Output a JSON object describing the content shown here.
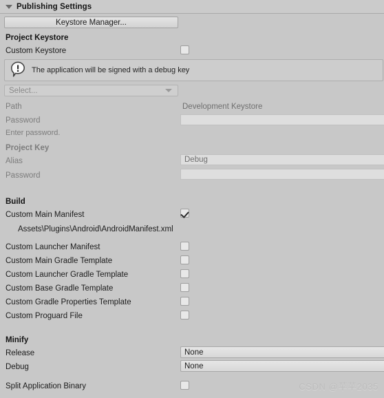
{
  "header": {
    "title": "Publishing Settings",
    "foldout_icon": "triangle-down-icon"
  },
  "keystore_manager_button": {
    "label": "Keystore Manager..."
  },
  "sections": {
    "project_keystore": {
      "title": "Project Keystore",
      "custom_keystore": {
        "label": "Custom Keystore",
        "checked": false
      },
      "helpbox": {
        "icon": "info-exclamation-icon",
        "text": "The application will be signed with a debug key"
      },
      "keystore_select": {
        "value": "Select...",
        "arrow_icon": "chevron-down-icon"
      },
      "path": {
        "label": "Path",
        "value": "Development Keystore"
      },
      "password": {
        "label": "Password",
        "value": "",
        "hint": "Enter password."
      }
    },
    "project_key": {
      "title": "Project Key",
      "alias": {
        "label": "Alias",
        "value": "Debug"
      },
      "password": {
        "label": "Password",
        "value": ""
      }
    },
    "build": {
      "title": "Build",
      "custom_main_manifest": {
        "label": "Custom Main Manifest",
        "checked": true,
        "path": "Assets\\Plugins\\Android\\AndroidManifest.xml"
      },
      "items": [
        {
          "label": "Custom Launcher Manifest",
          "checked": false
        },
        {
          "label": "Custom Main Gradle Template",
          "checked": false
        },
        {
          "label": "Custom Launcher Gradle Template",
          "checked": false
        },
        {
          "label": "Custom Base Gradle Template",
          "checked": false
        },
        {
          "label": "Custom Gradle Properties Template",
          "checked": false
        },
        {
          "label": "Custom Proguard File",
          "checked": false
        }
      ]
    },
    "minify": {
      "title": "Minify",
      "release": {
        "label": "Release",
        "value": "None"
      },
      "debug": {
        "label": "Debug",
        "value": "None"
      },
      "split_application_binary": {
        "label": "Split Application Binary",
        "checked": false
      }
    }
  },
  "watermark": {
    "text": "CSDN @苹苹2035"
  },
  "colors": {
    "panel_bg": "#c8c8c8",
    "field_bg": "#dedede",
    "button_bg": "#dcdcdc",
    "text": "#1b1b1b",
    "text_dim": "#7c7c7c",
    "border": "#a8a8a8"
  }
}
